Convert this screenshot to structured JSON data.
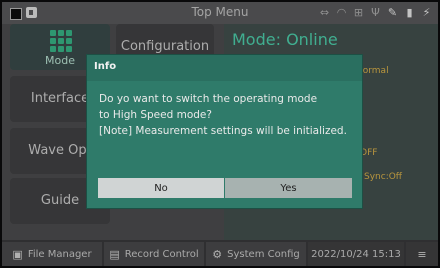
{
  "window": {
    "title": "Top Menu"
  },
  "status_icons": [
    "ethernet-icon",
    "wifi-icon",
    "network-icon",
    "usb-icon",
    "wrench-icon",
    "storage-icon",
    "power-plug-icon"
  ],
  "nav": {
    "mode": "Mode",
    "configuration": "Configuration",
    "interface": "Interface",
    "wave_output": "Wave Opt",
    "guide": "Guide"
  },
  "panel": {
    "heading": "Mode: Online",
    "peek_normal": "Normal",
    "peek_off": "OFF",
    "peek_sync": "Sync:Off"
  },
  "bottom": {
    "file_manager": "File Manager",
    "record_control": "Record Control",
    "system_config": "System Config",
    "datetime": "2022/10/24  15:13"
  },
  "dialog": {
    "title": "Info",
    "line1": "Do yo want to switch the operating mode",
    "line2": "to High Speed mode?",
    "line3": "[Note] Measurement settings will be initialized.",
    "no_label": "No",
    "yes_label": "Yes"
  },
  "colors": {
    "accent": "#39b98a",
    "dialog_bg": "#2f7b6a",
    "mode_heading": "#4fd5b0"
  }
}
